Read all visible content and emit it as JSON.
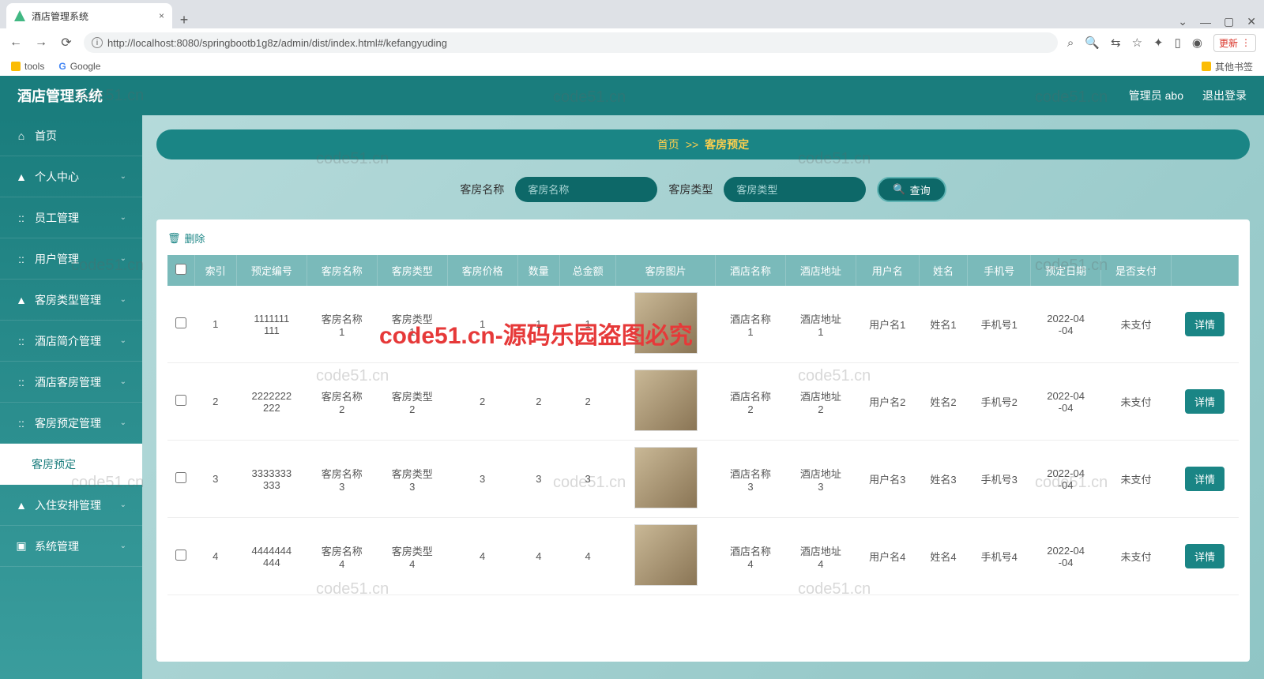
{
  "browser": {
    "tab_title": "酒店管理系统",
    "url": "http://localhost:8080/springbootb1g8z/admin/dist/index.html#/kefangyuding",
    "update": "更新",
    "bookmarks": {
      "tools": "tools",
      "google": "Google",
      "other": "其他书签"
    }
  },
  "header": {
    "title": "酒店管理系统",
    "user": "管理员 abo",
    "logout": "退出登录"
  },
  "sidebar": [
    {
      "icon": "⌂",
      "label": "首页",
      "chev": false
    },
    {
      "icon": "▲",
      "label": "个人中心",
      "chev": true
    },
    {
      "icon": "::",
      "label": "员工管理",
      "chev": true
    },
    {
      "icon": "::",
      "label": "用户管理",
      "chev": true
    },
    {
      "icon": "▲",
      "label": "客房类型管理",
      "chev": true
    },
    {
      "icon": "::",
      "label": "酒店简介管理",
      "chev": true
    },
    {
      "icon": "::",
      "label": "酒店客房管理",
      "chev": true
    },
    {
      "icon": "::",
      "label": "客房预定管理",
      "chev": true
    },
    {
      "icon": "",
      "label": "客房预定",
      "chev": false,
      "active": true
    },
    {
      "icon": "▲",
      "label": "入住安排管理",
      "chev": true
    },
    {
      "icon": "▣",
      "label": "系统管理",
      "chev": true
    }
  ],
  "breadcrumb": {
    "home": "首页",
    "sep": ">>",
    "current": "客房预定"
  },
  "search": {
    "label1": "客房名称",
    "ph1": "客房名称",
    "label2": "客房类型",
    "ph2": "客房类型",
    "btn": "查询"
  },
  "toolbar": {
    "delete": "删除"
  },
  "columns": [
    "",
    "索引",
    "预定编号",
    "客房名称",
    "客房类型",
    "客房价格",
    "数量",
    "总金额",
    "客房图片",
    "酒店名称",
    "酒店地址",
    "用户名",
    "姓名",
    "手机号",
    "预定日期",
    "是否支付",
    ""
  ],
  "rows": [
    {
      "idx": "1",
      "no": "1111111111",
      "room": "客房名称1",
      "type": "客房类型1",
      "price": "1",
      "qty": "1",
      "total": "1",
      "hotel": "酒店名称1",
      "addr": "酒店地址1",
      "user": "用户名1",
      "name": "姓名1",
      "phone": "手机号1",
      "date": "2022-04-04",
      "paid": "未支付"
    },
    {
      "idx": "2",
      "no": "2222222222",
      "room": "客房名称2",
      "type": "客房类型2",
      "price": "2",
      "qty": "2",
      "total": "2",
      "hotel": "酒店名称2",
      "addr": "酒店地址2",
      "user": "用户名2",
      "name": "姓名2",
      "phone": "手机号2",
      "date": "2022-04-04",
      "paid": "未支付"
    },
    {
      "idx": "3",
      "no": "3333333333",
      "room": "客房名称3",
      "type": "客房类型3",
      "price": "3",
      "qty": "3",
      "total": "3",
      "hotel": "酒店名称3",
      "addr": "酒店地址3",
      "user": "用户名3",
      "name": "姓名3",
      "phone": "手机号3",
      "date": "2022-04-04",
      "paid": "未支付"
    },
    {
      "idx": "4",
      "no": "4444444444",
      "room": "客房名称4",
      "type": "客房类型4",
      "price": "4",
      "qty": "4",
      "total": "4",
      "hotel": "酒店名称4",
      "addr": "酒店地址4",
      "user": "用户名4",
      "name": "姓名4",
      "phone": "手机号4",
      "date": "2022-04-04",
      "paid": "未支付"
    }
  ],
  "detail_btn": "详情",
  "watermarks": {
    "main": "code51.cn-源码乐园盗图必究",
    "small": "code51.cn"
  }
}
